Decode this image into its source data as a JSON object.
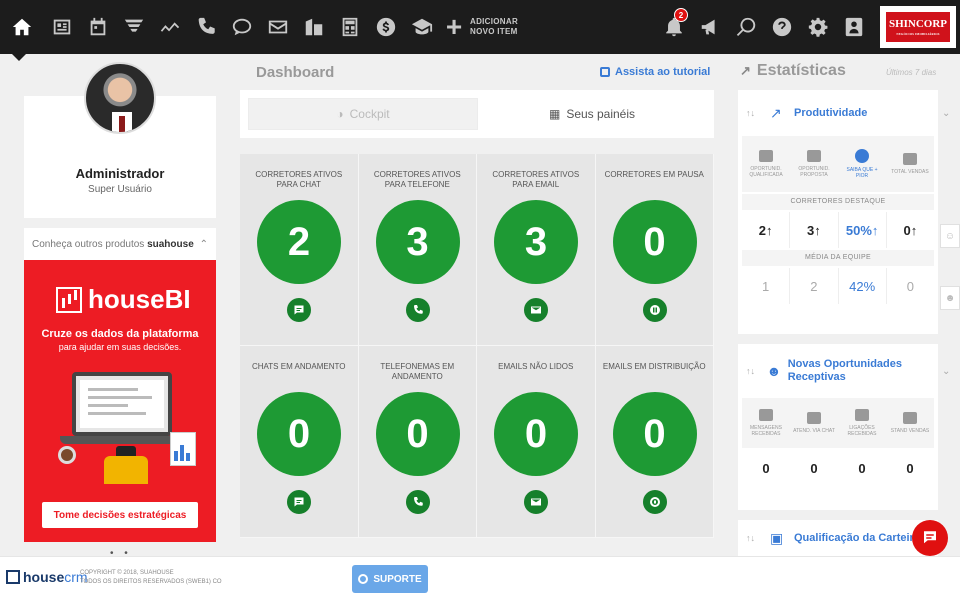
{
  "nav": {
    "add_item_line1": "ADICIONAR",
    "add_item_line2": "NOVO ITEM",
    "notification_count": "2",
    "brand_name": "SHINCORP",
    "brand_tagline": "NEGÓCIOS IMOBILIÁRIOS"
  },
  "profile": {
    "name": "Administrador",
    "role": "Super Usuário"
  },
  "promo": {
    "header_text": "Conheça outros produtos",
    "header_brand": "suahouse",
    "logo_text": "houseBI",
    "line1": "Cruze os dados da plataforma",
    "line2": "para ajudar em suas decisões.",
    "button": "Tome decisões estratégicas"
  },
  "dashboard": {
    "title": "Dashboard",
    "tutorial_link": "Assista ao tutorial",
    "tabs": [
      {
        "label": "Cockpit",
        "active": false
      },
      {
        "label": "Seus painéis",
        "active": true
      }
    ],
    "widgets": [
      {
        "label": "Corretores ativos para chat",
        "value": "2",
        "icon": "chat-icon"
      },
      {
        "label": "Corretores ativos para telefone",
        "value": "3",
        "icon": "phone-icon"
      },
      {
        "label": "Corretores ativos para email",
        "value": "3",
        "icon": "email-icon"
      },
      {
        "label": "Corretores em pausa",
        "value": "0",
        "icon": "pause-icon"
      },
      {
        "label": "Chats em andamento",
        "value": "0",
        "icon": "chat-icon"
      },
      {
        "label": "Telefonemas em andamento",
        "value": "0",
        "icon": "phone-icon"
      },
      {
        "label": "Emails não lidos",
        "value": "0",
        "icon": "email-icon"
      },
      {
        "label": "Emails em distribuição",
        "value": "0",
        "icon": "distribution-icon"
      }
    ]
  },
  "stats": {
    "title": "Estatísticas",
    "subtitle": "Últimos 7 dias",
    "productivity": {
      "title": "Produtividade",
      "icon_labels": [
        "Oportunid. qualificada",
        "Oportunid. proposta",
        "Saiba que + pior",
        "Total vendas"
      ],
      "section1": "Corretores destaque",
      "top_values": [
        "2↑",
        "3↑",
        "50%↑",
        "0↑"
      ],
      "section2": "Média da equipe",
      "avg_values": [
        "1",
        "2",
        "42%",
        "0"
      ]
    },
    "receptive": {
      "title": "Novas Oportunidades Receptivas",
      "icon_labels": [
        "Mensagens recebidas",
        "Atend. via chat",
        "Ligações recebidas",
        "Stand vendas"
      ],
      "values": [
        "0",
        "0",
        "0",
        "0"
      ]
    },
    "portfolio": {
      "title": "Qualificação da Carteira"
    }
  },
  "footer": {
    "logo_house": "house",
    "logo_crm": "crm",
    "copyright_line1": "COPYRIGHT © 2018, SUAHOUSE",
    "copyright_line2": "TODOS OS DIREITOS RESERVADOS (SWEB1) CO",
    "support_button": "SUPORTE"
  },
  "colors": {
    "accent": "#3a7bd5",
    "widget_green": "#1e9a34",
    "brand_red": "#ed1c24",
    "nav_bg": "#1c1c1c"
  }
}
